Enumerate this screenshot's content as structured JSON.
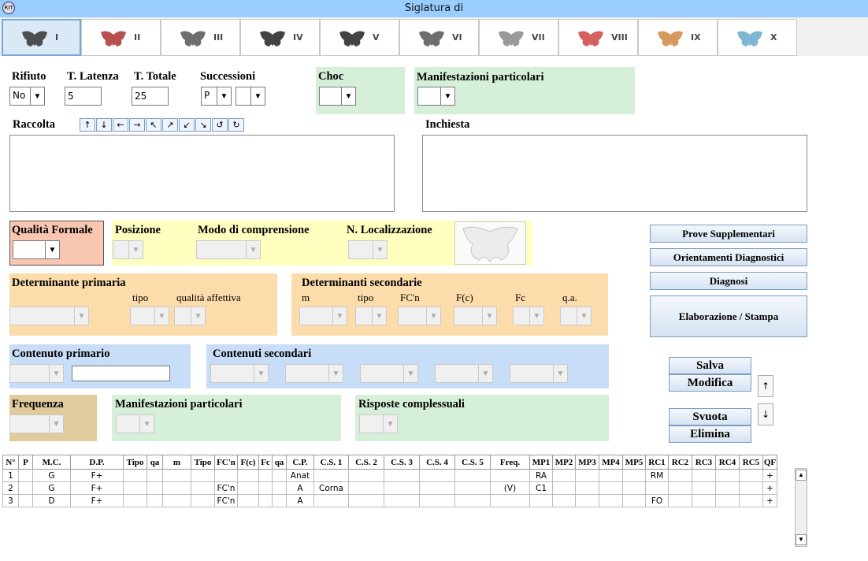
{
  "window": {
    "title": "Siglatura di",
    "icon_text": "RIT"
  },
  "tabs": [
    {
      "label": "I",
      "color": "#333"
    },
    {
      "label": "II",
      "color": "#a33"
    },
    {
      "label": "III",
      "color": "#555"
    },
    {
      "label": "IV",
      "color": "#222"
    },
    {
      "label": "V",
      "color": "#222"
    },
    {
      "label": "VI",
      "color": "#555"
    },
    {
      "label": "VII",
      "color": "#888"
    },
    {
      "label": "VIII",
      "color": "#c44"
    },
    {
      "label": "IX",
      "color": "#c84"
    },
    {
      "label": "X",
      "color": "#6ac"
    }
  ],
  "colors": {
    "green": "#d6efd9",
    "salmon": "#f8c6b1",
    "yellow": "#ffffc0",
    "orange": "#fbdcaa",
    "blue": "#c8ddf7",
    "tan": "#e0cb9c",
    "accent": "#7aa7d6"
  },
  "top": {
    "rifiuto": {
      "label": "Rifiuto",
      "value": "No"
    },
    "latenza": {
      "label": "T. Latenza",
      "value": "5"
    },
    "totale": {
      "label": "T. Totale",
      "value": "25"
    },
    "successioni": {
      "label": "Successioni",
      "value": "P",
      "value2": ""
    },
    "choc": {
      "label": "Choc",
      "value": ""
    },
    "manif": {
      "label": "Manifestazioni particolari",
      "value": ""
    }
  },
  "raccolta": {
    "label": "Raccolta",
    "arrows": [
      "↑",
      "↓",
      "←",
      "→",
      "↖",
      "↗",
      "↙",
      "↘",
      "↺",
      "↻"
    ]
  },
  "inchiesta": {
    "label": "Inchiesta"
  },
  "qualita": {
    "label": "Qualità Formale"
  },
  "posizione": {
    "label": "Posizione"
  },
  "modo": {
    "label": "Modo di comprensione"
  },
  "nloc": {
    "label": "N. Localizzazione"
  },
  "det_prim": {
    "label": "Determinante primaria",
    "tipo": "tipo",
    "qa": "qualità affettiva"
  },
  "det_sec": {
    "label": "Determinanti secondarie",
    "cols": [
      "m",
      "tipo",
      "FC'n",
      "F(c)",
      "Fc",
      "q.a."
    ]
  },
  "cont_prim": {
    "label": "Contenuto primario"
  },
  "cont_sec": {
    "label": "Contenuti secondari"
  },
  "frequenza": {
    "label": "Frequenza"
  },
  "manif2": {
    "label": "Manifestazioni particolari"
  },
  "complessuali": {
    "label": "Risposte complessuali"
  },
  "buttons": {
    "prove": "Prove Supplementari",
    "orient": "Orientamenti Diagnostici",
    "diagnosi": "Diagnosi",
    "elab": "Elaborazione / Stampa",
    "salva": "Salva",
    "modifica": "Modifica",
    "svuota": "Svuota",
    "elimina": "Elimina",
    "up": "↑",
    "down": "↓"
  },
  "table": {
    "headers": [
      "N°",
      "P",
      "M.C.",
      "D.P.",
      "Tipo",
      "qa",
      "m",
      "Tipo",
      "FC'n",
      "F(c)",
      "Fc",
      "qa",
      "C.P.",
      "C.S. 1",
      "C.S. 2",
      "C.S. 3",
      "C.S. 4",
      "C.S. 5",
      "Freq.",
      "MP1",
      "MP2",
      "MP3",
      "MP4",
      "MP5",
      "RC1",
      "RC2",
      "RC3",
      "RC4",
      "RC5",
      "QF"
    ],
    "rows": [
      [
        "1",
        "",
        "G",
        "F+",
        "",
        "",
        "",
        "",
        "",
        "",
        "",
        "",
        "Anat",
        "",
        "",
        "",
        "",
        "",
        "",
        "RA",
        "",
        "",
        "",
        "",
        "RM",
        "",
        "",
        "",
        "",
        "+"
      ],
      [
        "2",
        "",
        "G",
        "F+",
        "",
        "",
        "",
        "",
        "FC'n",
        "",
        "",
        "",
        "A",
        "Corna",
        "",
        "",
        "",
        "",
        "(V)",
        "C1",
        "",
        "",
        "",
        "",
        "",
        "",
        "",
        "",
        "",
        "+"
      ],
      [
        "3",
        "",
        "D",
        "F+",
        "",
        "",
        "",
        "",
        "FC'n",
        "",
        "",
        "",
        "A",
        "",
        "",
        "",
        "",
        "",
        "",
        "",
        "",
        "",
        "",
        "",
        "FO",
        "",
        "",
        "",
        "",
        "+"
      ]
    ]
  }
}
